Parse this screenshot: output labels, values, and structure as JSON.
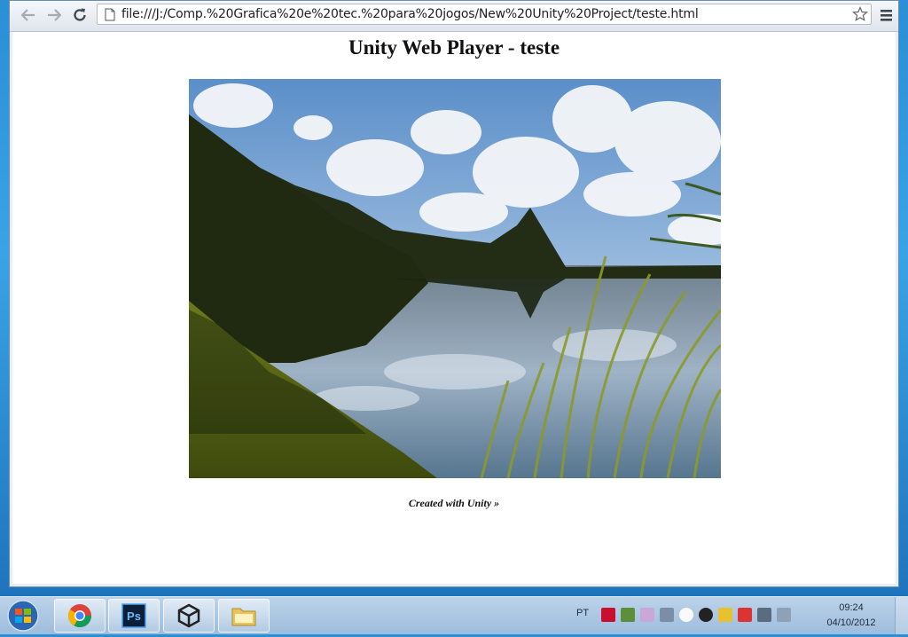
{
  "browser": {
    "url": "file:///J:/Comp.%20Grafica%20e%20tec.%20para%20jogos/New%20Unity%20Project/teste.html",
    "back_icon": "arrow-left-icon",
    "forward_icon": "arrow-right-icon",
    "reload_icon": "reload-icon",
    "bookmark_icon": "star-icon",
    "menu_icon": "hamburger-menu-icon"
  },
  "page": {
    "title": "Unity Web Player - teste",
    "player_content": "Unity scene: lake with palm-covered hills, clouds and tall grass",
    "footer_link": "Created with Unity »"
  },
  "taskbar": {
    "apps": [
      {
        "name": "Google Chrome",
        "icon": "chrome-icon"
      },
      {
        "name": "Adobe Photoshop",
        "icon": "photoshop-icon"
      },
      {
        "name": "Unity",
        "icon": "unity-icon"
      },
      {
        "name": "Windows Explorer",
        "icon": "folder-icon"
      }
    ],
    "language": "PT",
    "time": "09:24",
    "date": "04/10/2012"
  }
}
